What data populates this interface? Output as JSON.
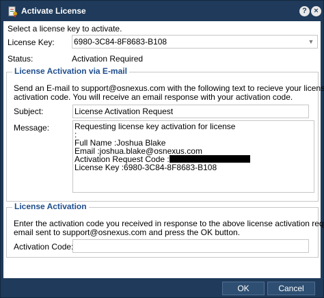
{
  "window": {
    "title": "Activate License",
    "help_glyph": "?",
    "close_glyph": "×",
    "icon": "license-icon"
  },
  "intro": "Select a license key to activate.",
  "license_key": {
    "label": "License Key:",
    "value": "6980-3C84-8F8683-B108"
  },
  "status": {
    "label": "Status:",
    "value": "Activation Required"
  },
  "email_group": {
    "title": "License Activation via E-mail",
    "instructions_line1": "Send an E-mail to support@osnexus.com with the following text to recieve your license",
    "instructions_line2": "activation code. You will receive an email response with your activation code.",
    "subject_label": "Subject:",
    "subject_value": "License Activation Request",
    "message_label": "Message:",
    "message_lines": [
      "Requesting license key activation for license",
      ":",
      "Full Name :Joshua Blake",
      "Email :joshua.blake@osnexus.com",
      "Activation Request Code :",
      "License Key :6980-3C84-8F8683-B108"
    ]
  },
  "activation_group": {
    "title": "License Activation",
    "instructions_line1": "Enter the activation code you received in response to the above license activation request",
    "instructions_line2": "email sent to support@osnexus.com and press the OK button.",
    "code_label": "Activation Code:",
    "code_value": ""
  },
  "buttons": {
    "ok": "OK",
    "cancel": "Cancel"
  },
  "colors": {
    "window": "#1f3a5a",
    "legend": "#1e4d8c",
    "border": "#c6c6c6"
  }
}
